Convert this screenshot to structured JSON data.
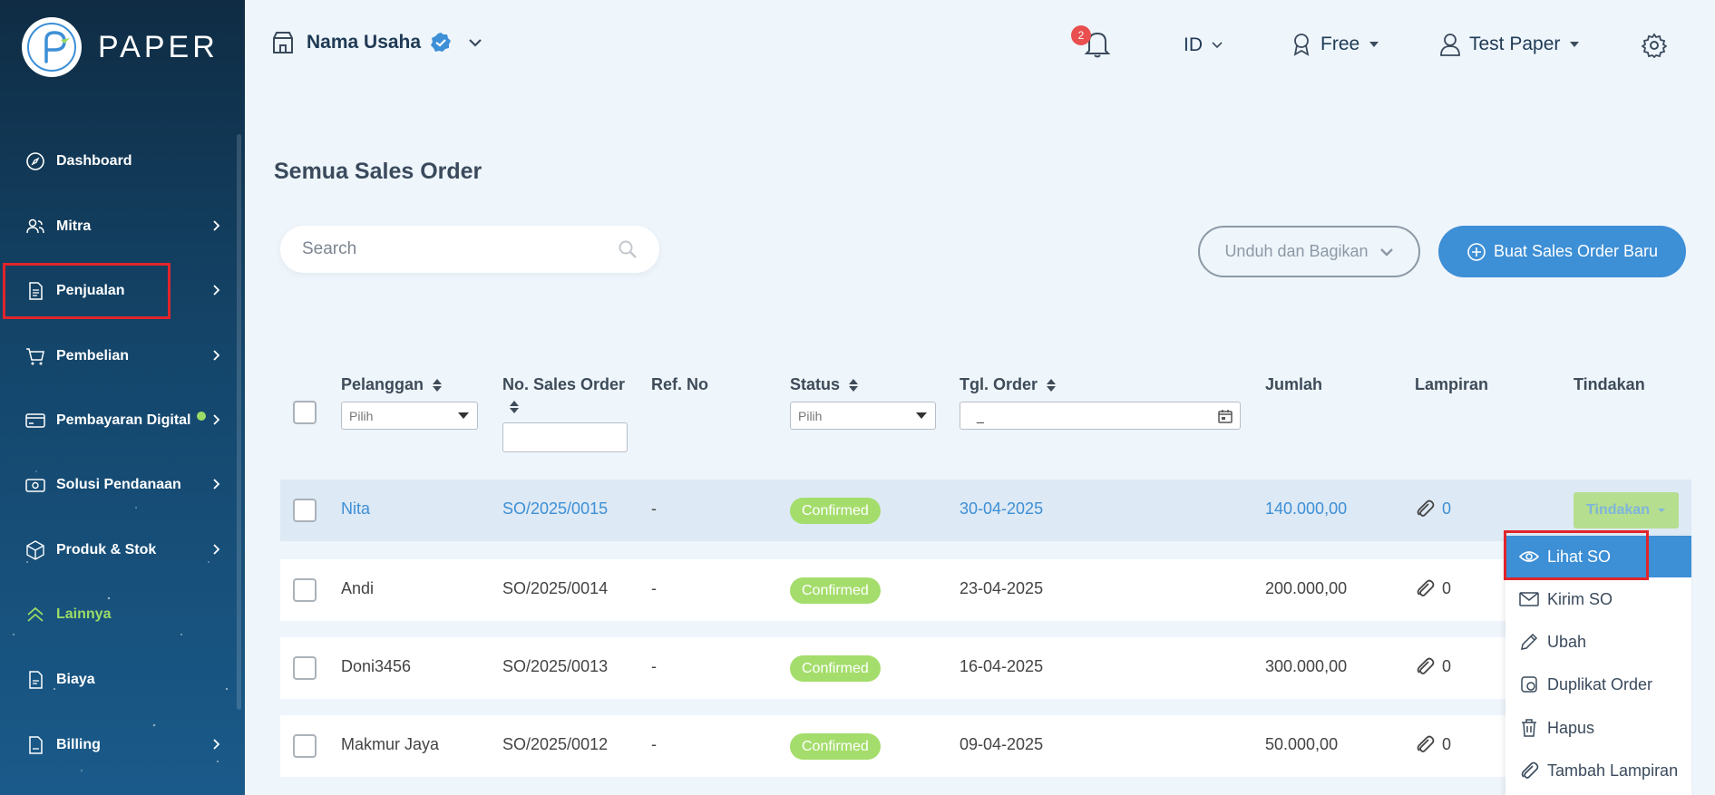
{
  "brand": {
    "name": "PAPER"
  },
  "sidebar": {
    "items": [
      {
        "label": "Dashboard",
        "icon": "compass-icon",
        "chevron": false
      },
      {
        "label": "Mitra",
        "icon": "users-icon",
        "chevron": true
      },
      {
        "label": "Penjualan",
        "icon": "document-icon",
        "chevron": true
      },
      {
        "label": "Pembelian",
        "icon": "cart-icon",
        "chevron": true
      },
      {
        "label": "Pembayaran Digital",
        "icon": "card-icon",
        "chevron": true,
        "dot": true
      },
      {
        "label": "Solusi Pendanaan",
        "icon": "wallet-icon",
        "chevron": true
      },
      {
        "label": "Produk & Stok",
        "icon": "box-icon",
        "chevron": true
      },
      {
        "label": "Lainnya",
        "icon": "chevrons-up-icon",
        "chevron": false,
        "active": true
      },
      {
        "label": "Biaya",
        "icon": "receipt-icon",
        "chevron": false
      },
      {
        "label": "Billing",
        "icon": "billing-icon",
        "chevron": true
      }
    ]
  },
  "topbar": {
    "store_name": "Nama Usaha",
    "notif_count": "2",
    "language": "ID",
    "plan": "Free",
    "user": "Test Paper"
  },
  "main": {
    "title": "Semua Sales Order",
    "search_placeholder": "Search",
    "download_label": "Unduh dan Bagikan",
    "create_label": "Buat Sales Order Baru"
  },
  "table": {
    "headers": {
      "customer": "Pelanggan",
      "so_no": "No. Sales Order",
      "ref": "Ref. No",
      "status": "Status",
      "date": "Tgl. Order",
      "amount": "Jumlah",
      "attachment": "Lampiran",
      "action": "Tindakan"
    },
    "filters": {
      "customer_select": "Pilih",
      "status_select": "Pilih",
      "date_value": "_"
    },
    "rows": [
      {
        "customer": "Nita",
        "so": "SO/2025/0015",
        "ref": "-",
        "status": "Confirmed",
        "date": "30-04-2025",
        "amount": "140.000,00",
        "attach": "0",
        "action": "Tindakan"
      },
      {
        "customer": "Andi",
        "so": "SO/2025/0014",
        "ref": "-",
        "status": "Confirmed",
        "date": "23-04-2025",
        "amount": "200.000,00",
        "attach": "0"
      },
      {
        "customer": "Doni3456",
        "so": "SO/2025/0013",
        "ref": "-",
        "status": "Confirmed",
        "date": "16-04-2025",
        "amount": "300.000,00",
        "attach": "0"
      },
      {
        "customer": "Makmur Jaya",
        "so": "SO/2025/0012",
        "ref": "-",
        "status": "Confirmed",
        "date": "09-04-2025",
        "amount": "50.000,00",
        "attach": "0"
      }
    ]
  },
  "action_menu": {
    "items": [
      {
        "label": "Lihat SO",
        "icon": "eye-icon"
      },
      {
        "label": "Kirim SO",
        "icon": "mail-icon"
      },
      {
        "label": "Ubah",
        "icon": "pencil-icon"
      },
      {
        "label": "Duplikat Order",
        "icon": "duplicate-icon"
      },
      {
        "label": "Hapus",
        "icon": "trash-icon"
      },
      {
        "label": "Tambah Lampiran",
        "icon": "paperclip-icon"
      }
    ]
  },
  "colors": {
    "primary": "#3d8fd6",
    "confirmed": "#a4dd6b",
    "highlight_box": "#e0252b",
    "sidebar_active": "#9bdc67"
  }
}
